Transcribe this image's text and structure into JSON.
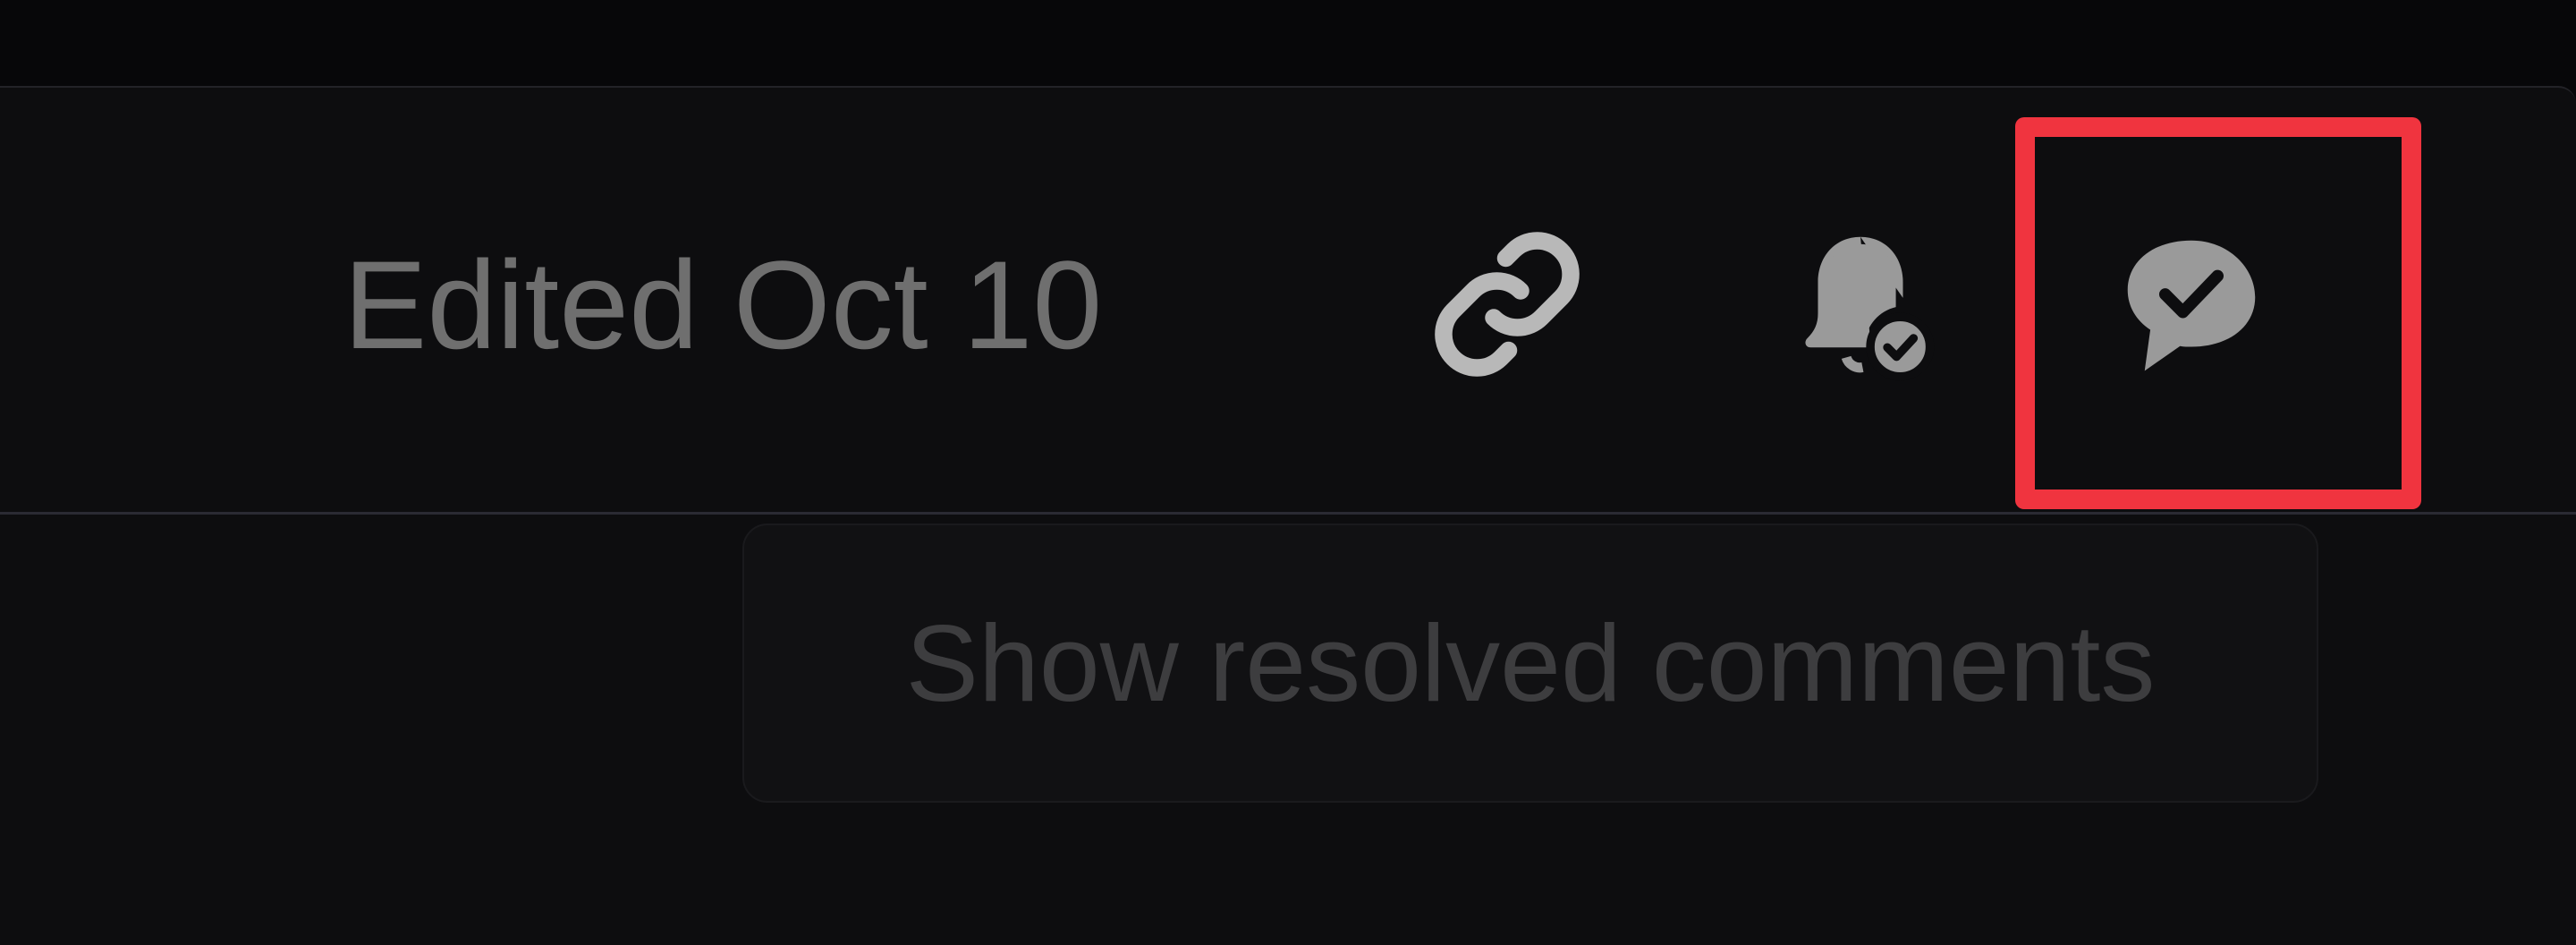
{
  "header": {
    "edited_label": "Edited Oct 10"
  },
  "actions": {
    "copy_link_icon": "link-icon",
    "notifications_icon": "bell-check-icon",
    "resolved_comments_icon": "comment-check-icon"
  },
  "tooltip": {
    "text": "Show resolved comments"
  },
  "colors": {
    "background": "#0d0d0f",
    "icon": "#8b8b8b",
    "highlight": "#f0343f",
    "muted_text": "#6f6f6f",
    "tooltip_text": "#3d3d3f"
  }
}
